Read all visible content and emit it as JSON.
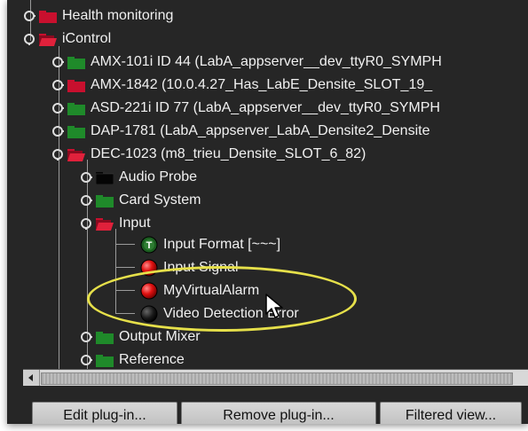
{
  "tree": {
    "items": [
      {
        "label": "Health monitoring",
        "folder_color": "red"
      },
      {
        "label": "iControl",
        "folder_color": "red-open"
      },
      {
        "label": "AMX-101i ID 44 (LabA_appserver__dev_ttyR0_SYMPH",
        "folder_color": "green"
      },
      {
        "label": "AMX-1842 (10.0.4.27_Has_LabE_Densite_SLOT_19_",
        "folder_color": "red"
      },
      {
        "label": "ASD-221i ID 77 (LabA_appserver__dev_ttyR0_SYMPH",
        "folder_color": "green"
      },
      {
        "label": "DAP-1781 (LabA_appserver_LabA_Densite2_Densite",
        "folder_color": "green"
      },
      {
        "label": "DEC-1023 (m8_trieu_Densite_SLOT_6_82)",
        "folder_color": "red-open"
      },
      {
        "label": "Audio Probe",
        "folder_color": "black"
      },
      {
        "label": "Card System",
        "folder_color": "green"
      },
      {
        "label": "Input",
        "folder_color": "red-open"
      },
      {
        "label": "Input Format [~~~]",
        "status": "T-green"
      },
      {
        "label": "Input Signal",
        "status": "red"
      },
      {
        "label": "MyVirtualAlarm",
        "status": "red"
      },
      {
        "label": "Video Detection Error",
        "status": "black"
      },
      {
        "label": "Output Mixer",
        "folder_color": "green"
      },
      {
        "label": "Reference",
        "folder_color": "green"
      }
    ]
  },
  "buttons": {
    "edit": "Edit plug-in...",
    "remove": "Remove plug-in...",
    "filtered": "Filtered view..."
  },
  "colors": {
    "background": "#262626",
    "folder_green": "#1f8a2a",
    "folder_red": "#c8102e",
    "highlight_ellipse": "#e6e04a"
  }
}
